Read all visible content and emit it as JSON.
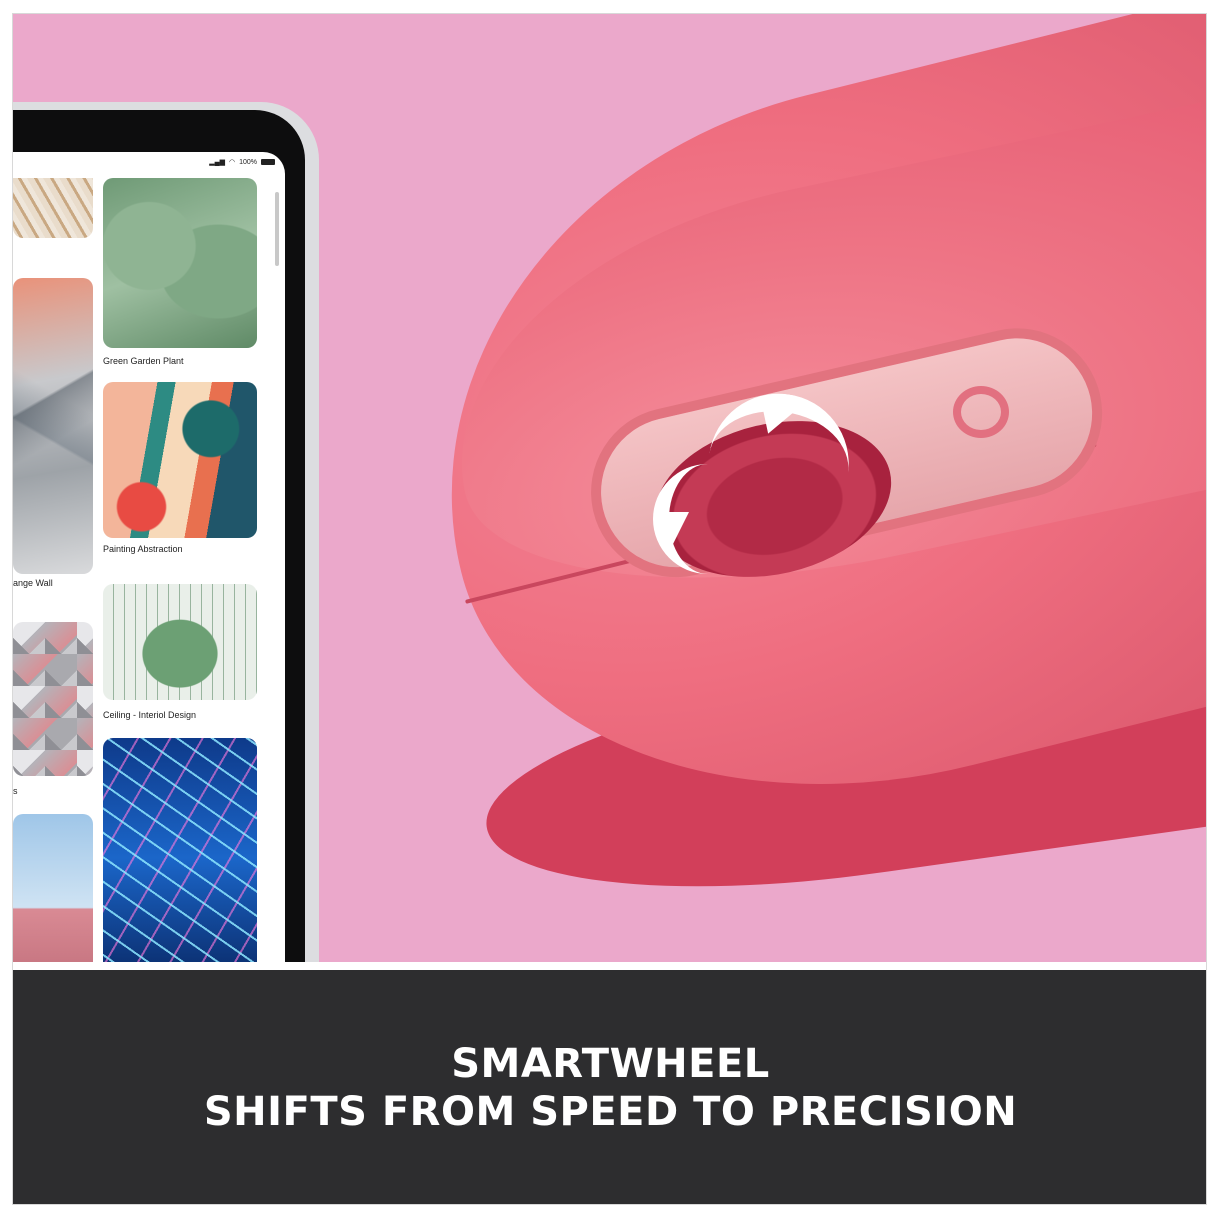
{
  "caption": {
    "line1": "SMARTWHEEL",
    "line2": "SHIFTS FROM SPEED TO PRECISION"
  },
  "tablet": {
    "status": "100%",
    "tiles": [
      {
        "label": "Green Garden Plant"
      },
      {
        "label": "Painting Abstraction"
      },
      {
        "label": "ange Wall"
      },
      {
        "label": "Ceiling - Interiol Design"
      },
      {
        "label": "s"
      }
    ]
  },
  "colors": {
    "background": "#eba8cb",
    "caption_band": "#2d2d2f",
    "mouse": "#ef6e80"
  }
}
